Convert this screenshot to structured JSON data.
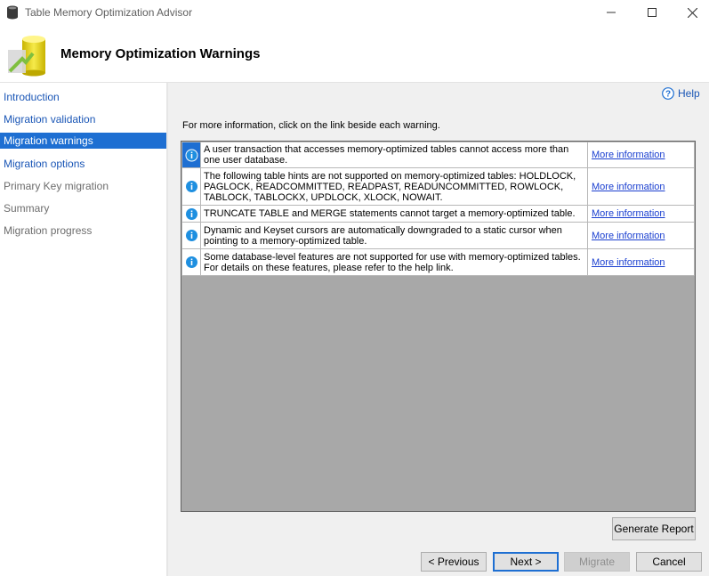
{
  "window": {
    "title": "Table Memory Optimization Advisor"
  },
  "header": {
    "title": "Memory Optimization Warnings"
  },
  "sidebar": {
    "items": [
      {
        "label": "Introduction",
        "state": "link"
      },
      {
        "label": "Migration validation",
        "state": "link"
      },
      {
        "label": "Migration warnings",
        "state": "active"
      },
      {
        "label": "Migration options",
        "state": "link"
      },
      {
        "label": "Primary Key migration",
        "state": "disabled"
      },
      {
        "label": "Summary",
        "state": "disabled"
      },
      {
        "label": "Migration progress",
        "state": "disabled"
      }
    ]
  },
  "main": {
    "help_label": "Help",
    "intro": "For more information, click on the link beside each warning.",
    "warnings": [
      {
        "message": "A user transaction that accesses memory-optimized tables cannot access more than one user database.",
        "link": "More information"
      },
      {
        "message": "The following table hints are not supported on memory-optimized tables: HOLDLOCK, PAGLOCK, READCOMMITTED, READPAST, READUNCOMMITTED, ROWLOCK, TABLOCK, TABLOCKX, UPDLOCK, XLOCK, NOWAIT.",
        "link": "More information"
      },
      {
        "message": "TRUNCATE TABLE and MERGE statements cannot target a memory-optimized table.",
        "link": "More information"
      },
      {
        "message": "Dynamic and Keyset cursors are automatically downgraded to a static cursor when pointing to a memory-optimized table.",
        "link": "More information"
      },
      {
        "message": "Some database-level features are not supported for use with memory-optimized tables. For details on these features, please refer to the help link.",
        "link": "More information"
      }
    ],
    "generate_report_label": "Generate Report"
  },
  "footer": {
    "previous_label": "< Previous",
    "next_label": "Next >",
    "migrate_label": "Migrate",
    "cancel_label": "Cancel"
  },
  "colors": {
    "accent": "#1e6fd2",
    "link": "#1a56b6",
    "info_icon": "#1e8fe0"
  }
}
